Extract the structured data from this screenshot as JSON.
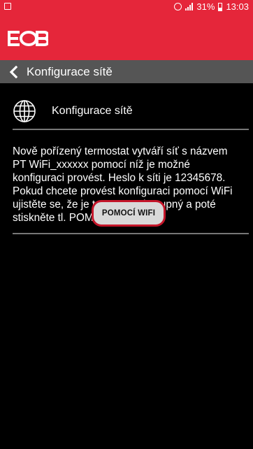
{
  "status_bar": {
    "signal_icon": "signal-icon",
    "alarm_icon": "alarm-icon",
    "battery_percent": "31%",
    "time": "13:03"
  },
  "brand": {
    "logo_text": "EOB",
    "color": "#e5263a"
  },
  "nav": {
    "title": "Konfigurace sítě",
    "back_icon": "chevron-left-icon",
    "bg": "#555555"
  },
  "section": {
    "icon": "globe-icon",
    "title": "Konfigurace sítě"
  },
  "description": "Nově pořízený termostat vytváří síť s názvem PT WiFi_xxxxxx pomocí níž je možné konfiguraci provést. Heslo k síti je 12345678. Pokud chcete provést konfiguraci pomocí WiFi ujistěte se, že je termostat dostupný a poté stiskněte tl. POMOCÍ WiFi.",
  "button": {
    "label": "POMOCÍ WIFI"
  }
}
